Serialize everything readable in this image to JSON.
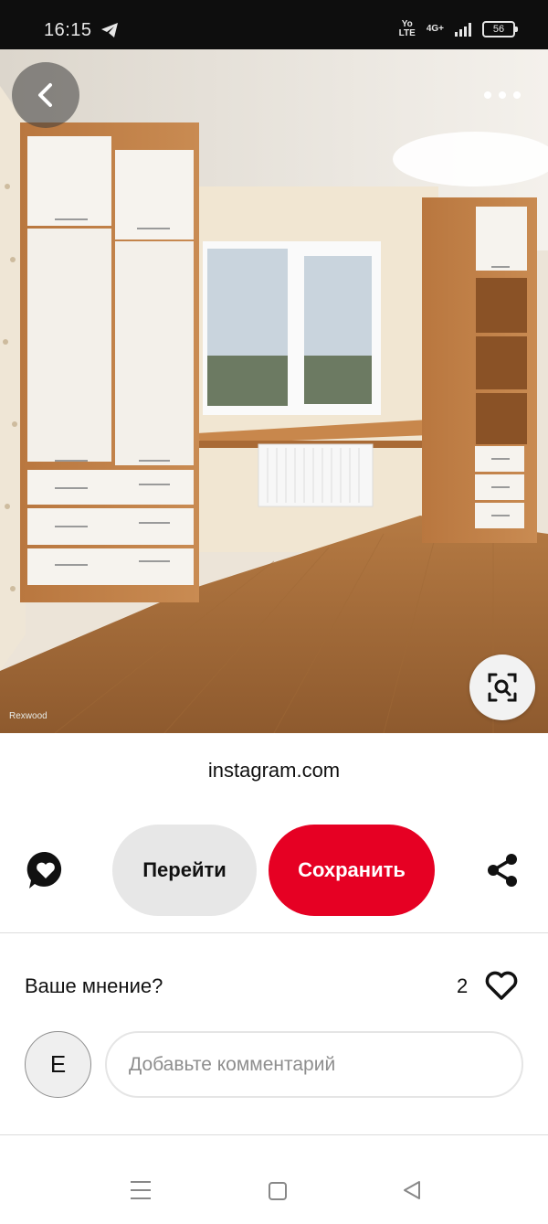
{
  "status_bar": {
    "time": "16:15",
    "network_top": "Yo",
    "network_bottom": "LTE",
    "net_type": "4G+",
    "battery": "56"
  },
  "pin": {
    "image_description_icon": "room-photo",
    "watermark": "Rexwood",
    "source": "instagram.com"
  },
  "actions": {
    "reaction_icon": "heart-speech-bubble-icon",
    "goto_label": "Перейти",
    "save_label": "Сохранить",
    "share_icon": "share-icon"
  },
  "comments": {
    "prompt": "Ваше мнение?",
    "like_count": "2",
    "avatar_letter": "E",
    "placeholder": "Добавьте комментарий"
  },
  "colors": {
    "accent": "#e60023",
    "secondary_button": "#e7e7e7"
  }
}
